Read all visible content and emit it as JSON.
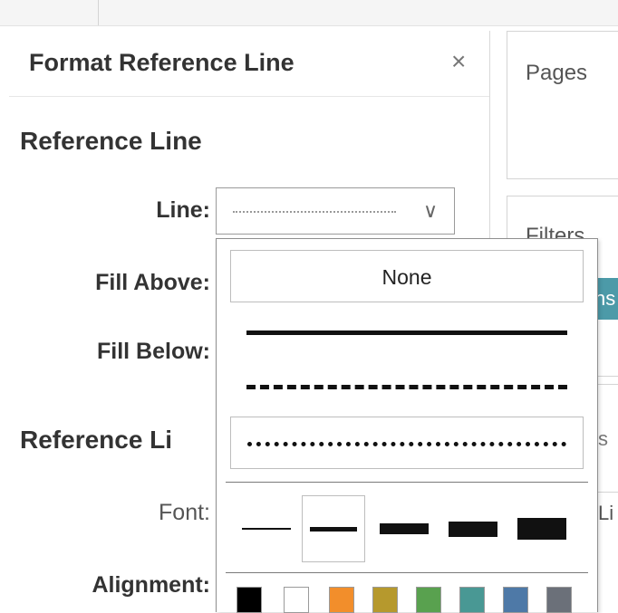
{
  "panel": {
    "title": "Format Reference Line",
    "close": "×",
    "section_reference_line": "Reference Line",
    "line_label": "Line:",
    "fill_above_label": "Fill Above:",
    "fill_below_label": "Fill Below:",
    "section_reference_label": "Reference Li",
    "font_label": "Font:",
    "alignment_label": "Alignment:"
  },
  "side": {
    "pages": "Pages",
    "filters": "Filters",
    "pill_fragment": "ns",
    "s_fragment": "s",
    "li_fragment": "Li"
  },
  "dropdown": {
    "none_label": "None",
    "line_styles": [
      "solid",
      "dashed",
      "fine-dashed"
    ],
    "selected_style": "fine-dashed",
    "weights": [
      1,
      2,
      3,
      4,
      5
    ],
    "selected_weight": 2,
    "colors": [
      "#000000",
      "#ffffff",
      "#f28e2b",
      "#b6992d",
      "#59a14f",
      "#499894",
      "#4e79a7",
      "#6b7079"
    ]
  },
  "colors": {
    "accent_teal": "#4c9aa8"
  }
}
